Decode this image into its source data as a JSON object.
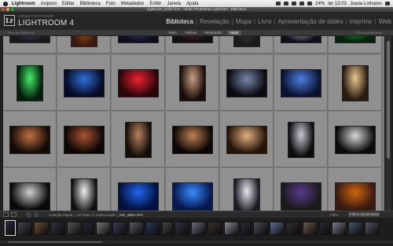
{
  "menubar": {
    "app": "Lightroom",
    "menus": [
      "Arquivo",
      "Editar",
      "Biblioteca",
      "Foto",
      "Metadados",
      "Exibir",
      "Janela",
      "Ajuda"
    ],
    "battery": "24%",
    "clock": "ter 13:03",
    "user": "Joana Linhares"
  },
  "window": {
    "title": "Lightroom_Edits.lrcat - Adobe Photoshop Lightroom - Biblioteca"
  },
  "identity": {
    "logo": "Lr",
    "brand_small": "ADOBE PHOTOSHOP",
    "brand": "LIGHTROOM 4"
  },
  "modules": [
    "Biblioteca",
    "Revelação",
    "Mapa",
    "Livro",
    "Apresentação de slides",
    "Imprimir",
    "Web"
  ],
  "active_module": "Biblioteca",
  "filterbar": {
    "left": "Filtro de Biblioteca:",
    "tabs": [
      "Texto",
      "Atributo",
      "Metadados",
      "Nada"
    ],
    "active_tab": "Nada",
    "right": "Filtros desativados"
  },
  "grid": {
    "photos": [
      {
        "colors": [
          "#1a1a1a",
          "#5a3b8e"
        ]
      },
      {
        "colors": [
          "#3a1a10",
          "#cc6611"
        ]
      },
      {
        "colors": [
          "#0e0e1c",
          "#3555aa"
        ]
      },
      {
        "colors": [
          "#111",
          "#7a2a4a"
        ]
      },
      {
        "colors": [
          "#1a1a1a",
          "#444"
        ]
      },
      {
        "colors": [
          "#101018",
          "#e0e0f0"
        ]
      },
      {
        "colors": [
          "#05220a",
          "#22cc33"
        ]
      },
      {
        "colors": [
          "#021d0a",
          "#44ee66"
        ]
      },
      {
        "colors": [
          "#050a25",
          "#2f6ed8"
        ]
      },
      {
        "colors": [
          "#2a0608",
          "#ee2233"
        ]
      },
      {
        "colors": [
          "#1a0c0a",
          "#c8a082"
        ]
      },
      {
        "colors": [
          "#0a0a10",
          "#7788aa"
        ]
      },
      {
        "colors": [
          "#0a1230",
          "#4d7fe0"
        ]
      },
      {
        "colors": [
          "#2a1a10",
          "#e8c890"
        ]
      },
      {
        "colors": [
          "#120a06",
          "#c07040"
        ]
      },
      {
        "colors": [
          "#0c0604",
          "#aa5533"
        ]
      },
      {
        "colors": [
          "#140e08",
          "#b88060"
        ]
      },
      {
        "colors": [
          "#0a0605",
          "#c08050"
        ]
      },
      {
        "colors": [
          "#261408",
          "#e0b080"
        ]
      },
      {
        "colors": [
          "#0c0c0c",
          "#c8c8d8"
        ]
      },
      {
        "colors": [
          "#0a0a0a",
          "#d8d8d8"
        ]
      },
      {
        "colors": [
          "#090909",
          "#cfcfcf"
        ]
      },
      {
        "colors": [
          "#101010",
          "#eeeeee"
        ]
      },
      {
        "colors": [
          "#031040",
          "#2266ee"
        ]
      },
      {
        "colors": [
          "#061850",
          "#3a8aff"
        ]
      },
      {
        "colors": [
          "#1a1a22",
          "#e8e8f0"
        ]
      }
    ]
  },
  "toolbar": {
    "collection": "Coleção rápida",
    "count": "67 fotos / 1 selecionada /",
    "file": "_MG_9953.JPG",
    "filter_label": "Filtro:",
    "filter_value": "Filtros desativados"
  },
  "filmstrip": {
    "colors": [
      "#2a2a40",
      "#445",
      "#6b4f35",
      "#334",
      "#555",
      "#282838",
      "#777",
      "#3a3a55",
      "#5a5a66",
      "#2a3a5a",
      "#4a4a4a",
      "#333347",
      "#6a6a78",
      "#3b3030",
      "#8a8a99",
      "#2f2f3f",
      "#4d4d5d",
      "#5f6f8f",
      "#303030",
      "#6a5a4a",
      "#2a2a35",
      "#7d7d8d",
      "#445566",
      "#555566"
    ]
  }
}
